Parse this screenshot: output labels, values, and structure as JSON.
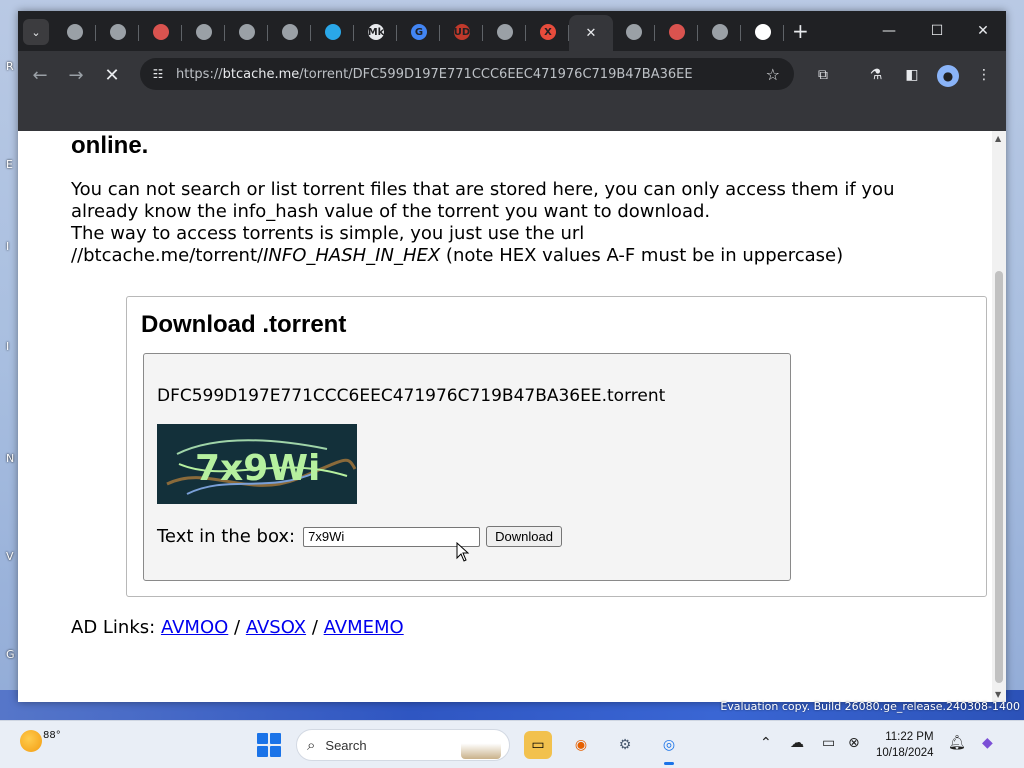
{
  "desktop": {
    "edge_letters": [
      "R",
      "E",
      "I",
      "I",
      "N",
      "V",
      "G"
    ],
    "evaluation_note": "Evaluation copy. Build 26080.ge_release.240308-1400"
  },
  "browser": {
    "tabs": [
      {
        "icon": "generic-tab-icon",
        "active": false
      },
      {
        "icon": "generic-tab-icon",
        "active": false
      },
      {
        "icon": "infinity-tab-icon",
        "active": false
      },
      {
        "icon": "globe-tab-icon",
        "active": false
      },
      {
        "icon": "blank-tab-icon",
        "active": false
      },
      {
        "icon": "globe-tab-icon",
        "active": false
      },
      {
        "icon": "blue-circle-tab-icon",
        "active": false
      },
      {
        "icon": "mk-tab-icon",
        "label": "Mk",
        "active": false
      },
      {
        "icon": "g-tab-icon",
        "label": "G",
        "active": false
      },
      {
        "icon": "ublock-tab-icon",
        "label": "UD",
        "active": false
      },
      {
        "icon": "globe-tab-icon",
        "active": false
      },
      {
        "icon": "x-tab-icon",
        "label": "X",
        "active": false
      },
      {
        "icon": "close-icon",
        "active": true
      },
      {
        "icon": "globe-tab-icon",
        "active": false
      },
      {
        "icon": "infinity-tab-icon",
        "active": false
      },
      {
        "icon": "globe-tab-icon",
        "active": false
      },
      {
        "icon": "white-square-tab-icon",
        "active": false
      }
    ],
    "address": {
      "scheme": "https://",
      "host": "btcache.me",
      "path": "/torrent/DFC599D197E771CCC6EEC471976C719B47BA36EE"
    }
  },
  "page": {
    "heading_tail": "online.",
    "paragraph_line1": "You can not search or list torrent files that are stored here, you can only access them if you already know the info_hash value of the torrent you want to download.",
    "paragraph_line2": "The way to access torrents is simple, you just use the url",
    "url_prefix": "//btcache.me/torrent/",
    "url_placeholder": "INFO_HASH_IN_HEX",
    "url_note": " (note HEX values A-F must be in uppercase)",
    "download_box": {
      "title": "Download .torrent",
      "filename": "DFC599D197E771CCC6EEC471976C719B47BA36EE.torrent",
      "captcha_text": "7x9Wi",
      "input_label": "Text in the box:",
      "input_value": "7x9Wi",
      "button_label": "Download"
    },
    "ad_links": {
      "label": "AD Links:",
      "links": [
        "AVMOO",
        "AVSOX",
        "AVMEMO"
      ],
      "separator": "/"
    }
  },
  "taskbar": {
    "temperature": "88°",
    "search_placeholder": "Search",
    "time": "11:22 PM",
    "date": "10/18/2024"
  }
}
